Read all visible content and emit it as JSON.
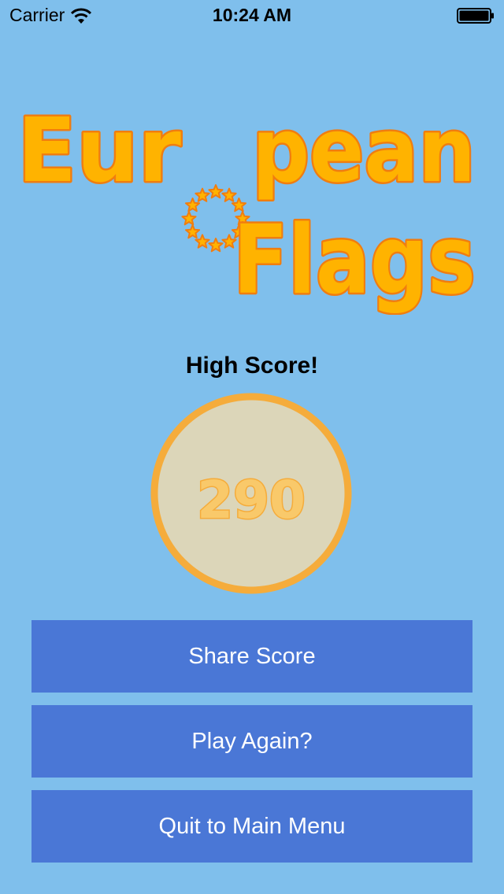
{
  "status_bar": {
    "carrier": "Carrier",
    "time": "10:24 AM"
  },
  "logo": {
    "line1": "Eur",
    "line1_end": "pean",
    "line2": "Flags",
    "fill_color": "#ffb300",
    "stroke_color": "#f07d10"
  },
  "result": {
    "heading": "High Score!",
    "score": "290"
  },
  "buttons": {
    "share": "Share Score",
    "play_again": "Play Again?",
    "quit": "Quit to Main Menu"
  },
  "colors": {
    "background": "#7fbfec",
    "button": "#4a77d6",
    "score_circle_fill": "#dcd6b9",
    "score_circle_border": "#f5ac3b"
  }
}
